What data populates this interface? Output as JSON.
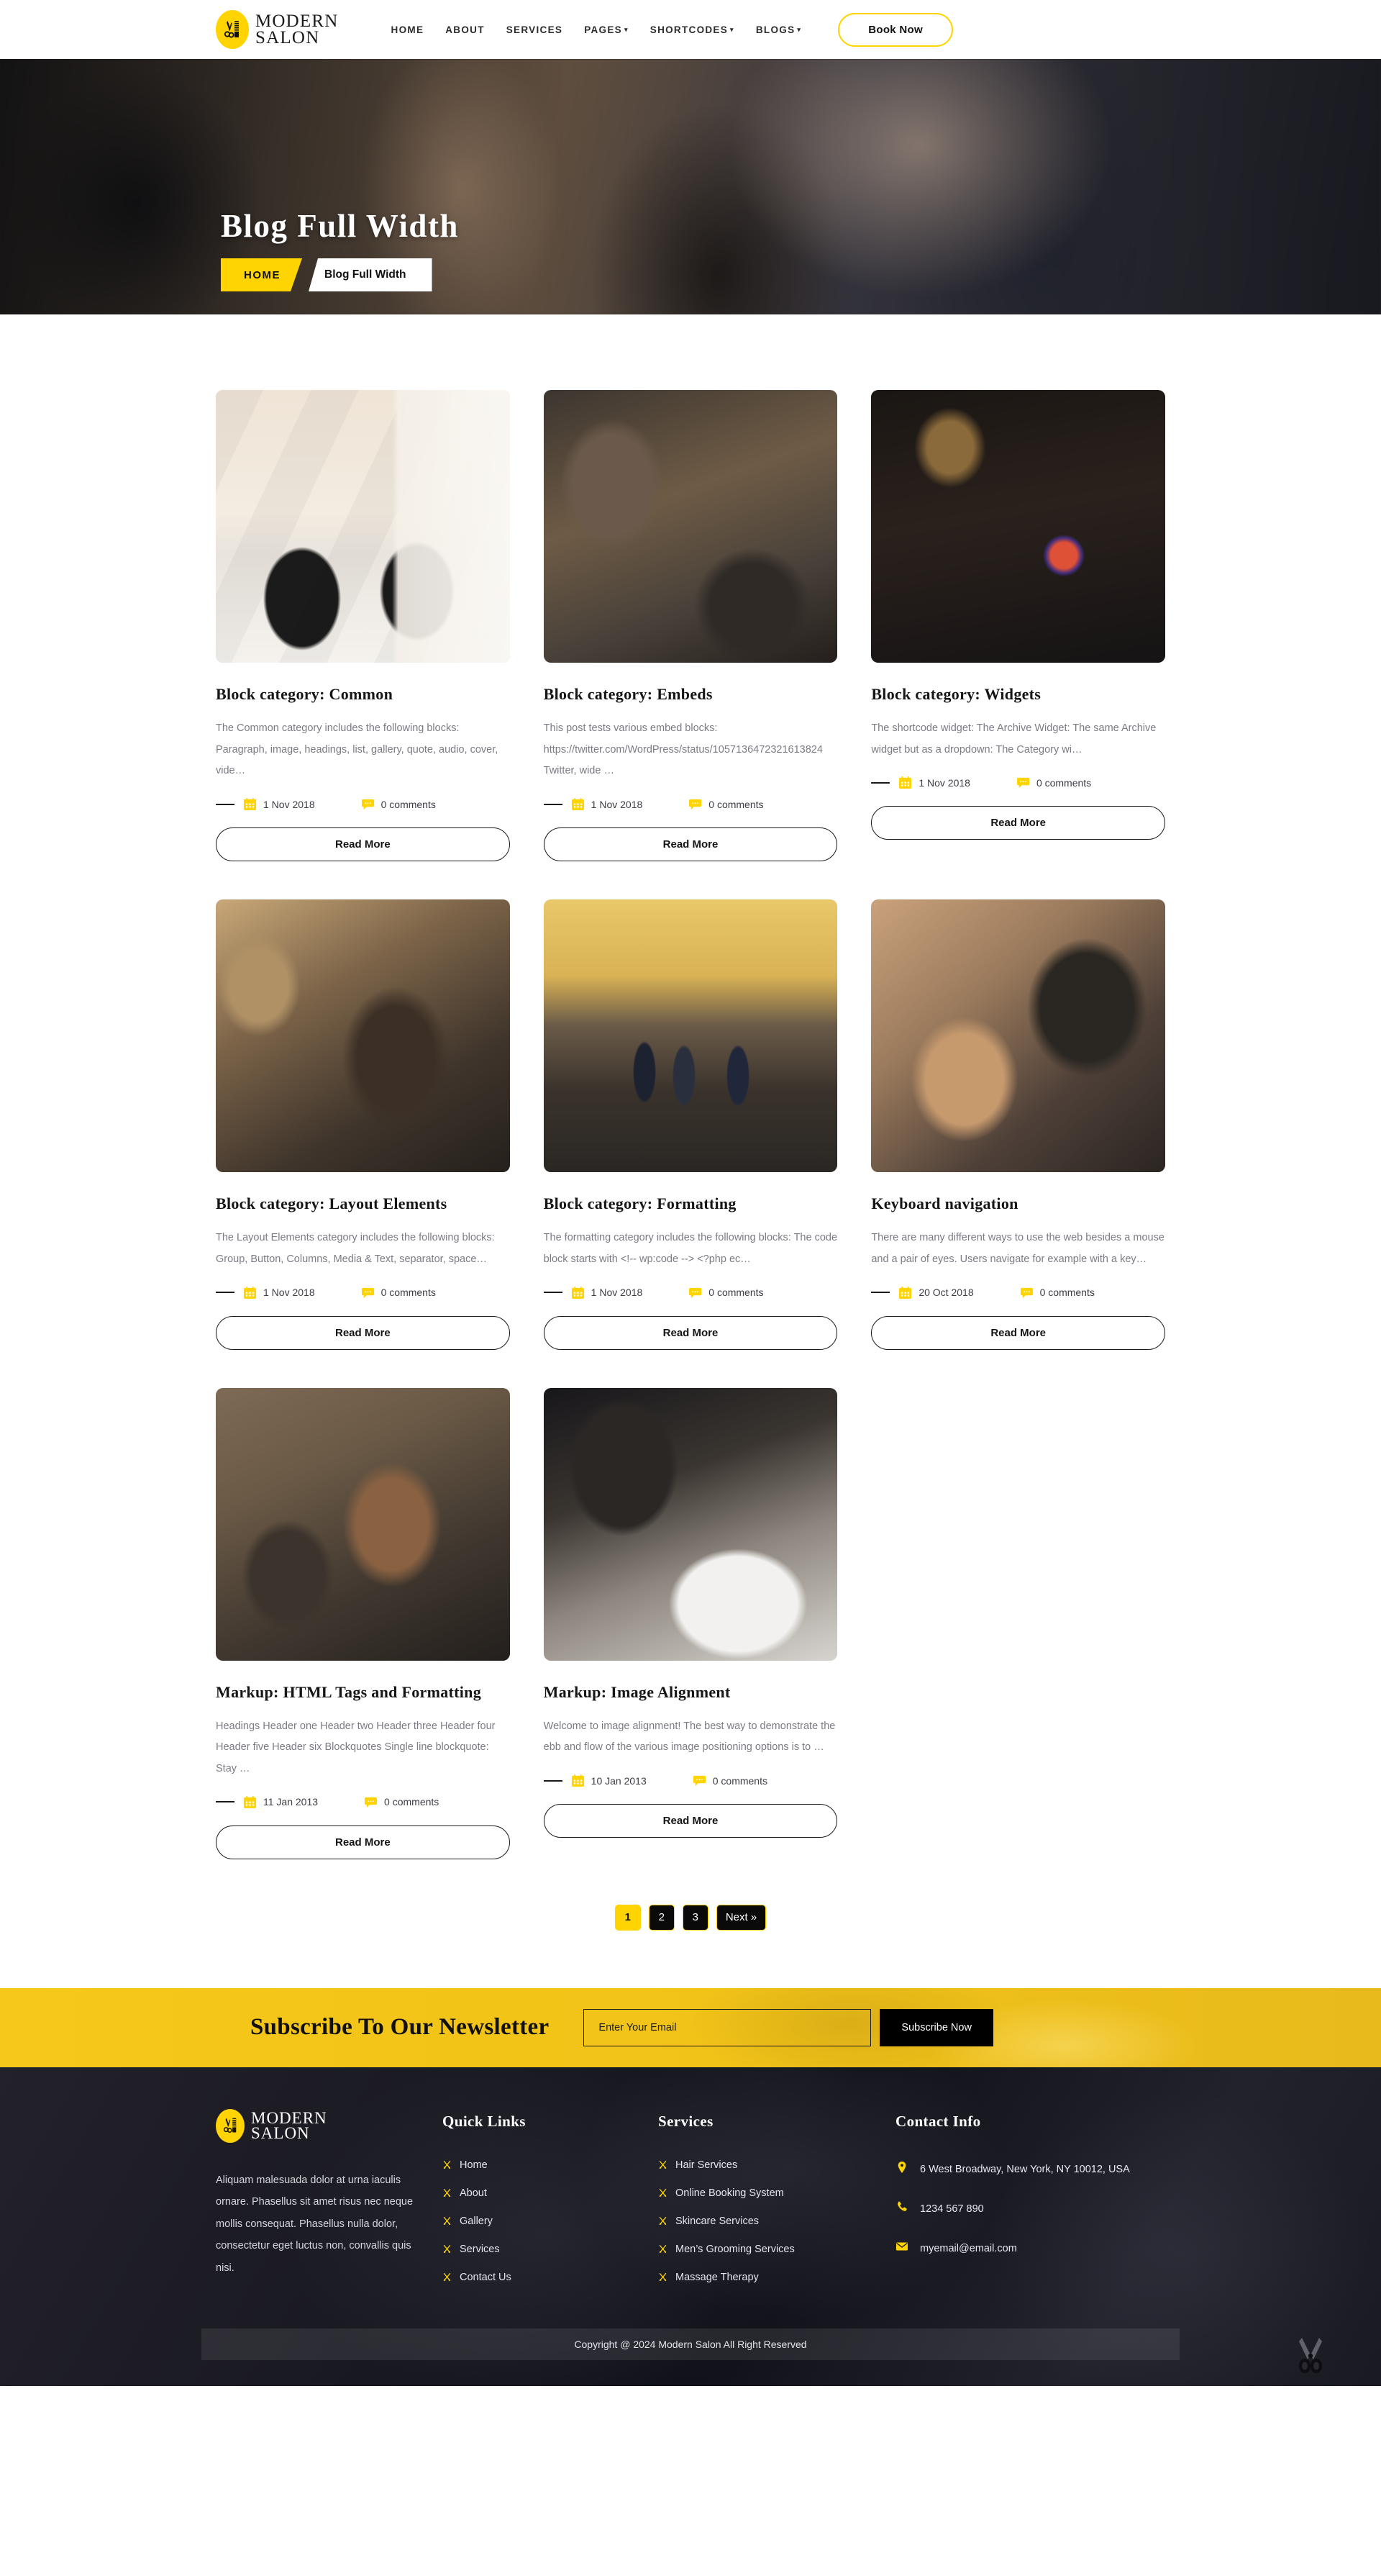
{
  "header": {
    "logo": {
      "line1": "MODERN",
      "line2": "SALON",
      "icon": "scissors-comb-icon"
    },
    "nav": [
      {
        "label": "HOME",
        "dropdown": false
      },
      {
        "label": "ABOUT",
        "dropdown": false
      },
      {
        "label": "SERVICES",
        "dropdown": false
      },
      {
        "label": "PAGES",
        "dropdown": true
      },
      {
        "label": "SHORTCODES",
        "dropdown": true
      },
      {
        "label": "BLOGS",
        "dropdown": true
      }
    ],
    "cta_label": "Book Now"
  },
  "hero": {
    "title": "Blog Full Width",
    "breadcrumb_home": "HOME",
    "breadcrumb_current": "Blog Full Width"
  },
  "posts": [
    {
      "title": "Block category: Common",
      "excerpt": "The Common category includes the following blocks: Paragraph, image, headings, list, gallery, quote, audio, cover, vide…",
      "date": "1 Nov 2018",
      "comments": "0 comments",
      "read_more": "Read More",
      "art": "art-salon"
    },
    {
      "title": "Block category: Embeds",
      "excerpt": "This post tests various embed blocks: https://twitter.com/WordPress/status/1057136472321613824 Twitter,  wide …",
      "date": "1 Nov 2018",
      "comments": "0 comments",
      "read_more": "Read More",
      "art": "art-embeds"
    },
    {
      "title": "Block category: Widgets",
      "excerpt": "The shortcode widget: The Archive Widget: The same Archive widget but as a dropdown: The Category wi…",
      "date": "1 Nov 2018",
      "comments": "0 comments",
      "read_more": "Read More",
      "art": "art-widgets"
    },
    {
      "title": "Block category: Layout Elements",
      "excerpt": "The Layout Elements category includes the following blocks: Group, Button, Columns, Media & Text, separator, space…",
      "date": "1 Nov 2018",
      "comments": "0 comments",
      "read_more": "Read More",
      "art": "art-layout"
    },
    {
      "title": "Block category: Formatting",
      "excerpt": "The formatting category includes the following blocks: The code block starts with <!-- wp:code --> <?php ec…",
      "date": "1 Nov 2018",
      "comments": "0 comments",
      "read_more": "Read More",
      "art": "art-formatting"
    },
    {
      "title": "Keyboard navigation",
      "excerpt": "There are many different ways to use the web besides a mouse and a pair of eyes. Users navigate for example with a key…",
      "date": "20 Oct 2018",
      "comments": "0 comments",
      "read_more": "Read More",
      "art": "art-keyboard"
    },
    {
      "title": "Markup: HTML Tags and Formatting",
      "excerpt": "Headings Header one Header two Header three Header four Header five Header six Blockquotes Single line blockquote: Stay …",
      "date": "11 Jan 2013",
      "comments": "0 comments",
      "read_more": "Read More",
      "art": "art-markup"
    },
    {
      "title": "Markup: Image Alignment",
      "excerpt": "Welcome to image alignment! The best way to demonstrate the ebb and flow of the various image positioning options is to …",
      "date": "10 Jan 2013",
      "comments": "0 comments",
      "read_more": "Read More",
      "art": "art-align"
    }
  ],
  "pagination": [
    {
      "label": "1",
      "active": true
    },
    {
      "label": "2",
      "active": false
    },
    {
      "label": "3",
      "active": false
    },
    {
      "label": "Next »",
      "active": false
    }
  ],
  "newsletter": {
    "title": "Subscribe To Our Newsletter",
    "placeholder": "Enter Your Email",
    "input_value": "",
    "button_label": "Subscribe Now"
  },
  "footer": {
    "logo": {
      "line1": "MODERN",
      "line2": "SALON",
      "icon": "scissors-comb-icon"
    },
    "about": "Aliquam malesuada dolor at urna iaculis ornare. Phasellus sit amet risus nec neque mollis consequat. Phasellus nulla dolor, consectetur eget luctus non, convallis quis nisi.",
    "quick_links": {
      "heading": "Quick Links",
      "items": [
        "Home",
        "About",
        "Gallery",
        "Services",
        "Contact Us"
      ]
    },
    "services": {
      "heading": "Services",
      "items": [
        "Hair Services",
        "Online Booking System",
        "Skincare Services",
        "Men’s Grooming Services",
        "Massage Therapy"
      ]
    },
    "contact": {
      "heading": "Contact Info",
      "address": "6 West Broadway, New York, NY 10012, USA",
      "phone": "1234 567 890",
      "email": "myemail@email.com"
    },
    "copyright": "Copyright @ 2024 Modern Salon All Right Reserved"
  },
  "colors": {
    "accent": "#FFD400",
    "newsletter_bg": "#F4C51C",
    "dark": "#15161d",
    "text_muted": "#7b7b85"
  }
}
